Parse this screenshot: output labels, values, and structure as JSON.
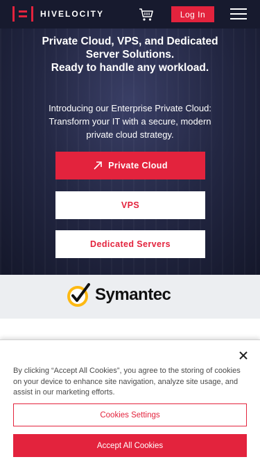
{
  "header": {
    "brand": "HIVELOCITY",
    "login_label": "Log In",
    "cart_icon": "cart-icon",
    "menu_icon": "hamburger-menu-icon",
    "background_color": "#171a2e",
    "accent_color": "#e3233d"
  },
  "hero": {
    "title_line1": "Private Cloud, VPS, and Dedicated",
    "title_line2": "Server Solutions.",
    "title_line3": "Ready to handle any workload.",
    "sub_line1": "Introducing our Enterprise Private Cloud:",
    "sub_line2": "Transform your IT with a secure, modern",
    "sub_line3": "private cloud strategy.",
    "buttons": [
      {
        "label": "Private Cloud",
        "icon": "arrow-up-right-icon"
      },
      {
        "label": "VPS"
      },
      {
        "label": "Dedicated Servers"
      }
    ]
  },
  "trust": {
    "brand": "Symantec",
    "badge_icon": "symantec-check-badge-icon"
  },
  "cookie": {
    "text": "By clicking “Accept All Cookies”, you agree to the storing of cookies on your device to enhance site navigation, analyze site usage, and assist in our marketing efforts.",
    "settings_label": "Cookies Settings",
    "accept_label": "Accept All Cookies",
    "close_icon": "close-icon"
  }
}
